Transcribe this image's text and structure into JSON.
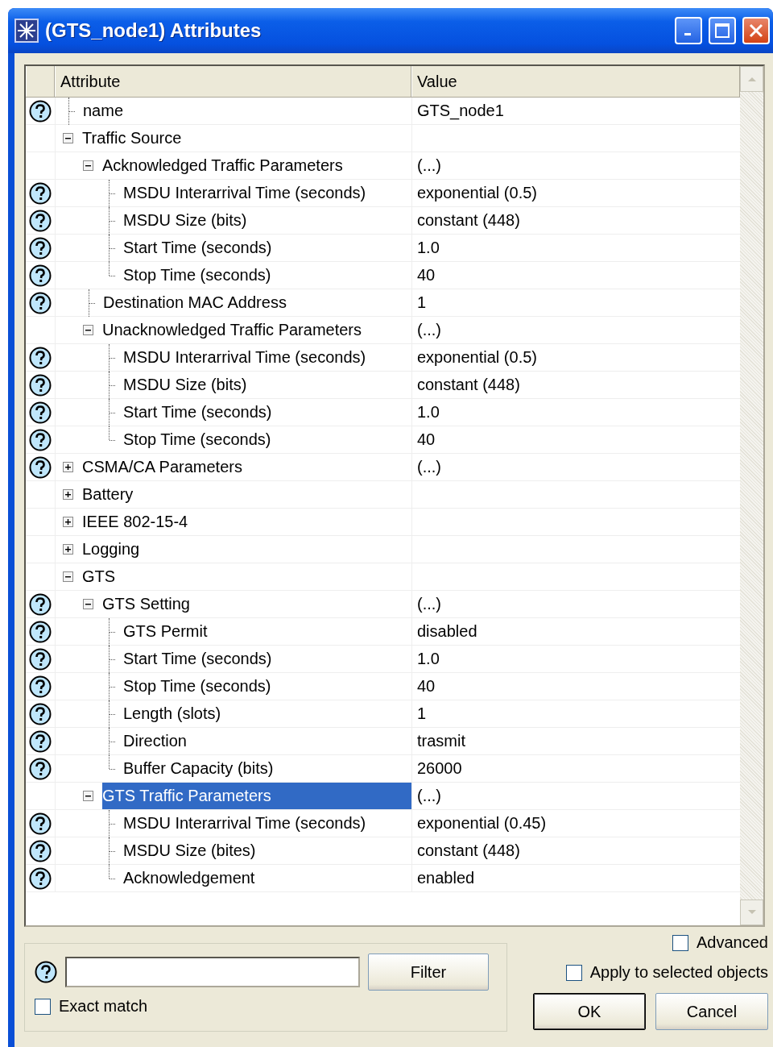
{
  "window": {
    "title": "(GTS_node1) Attributes"
  },
  "table": {
    "columns": [
      "Attribute",
      "Value"
    ],
    "rows": [
      {
        "label": "name",
        "value": "GTS_node1",
        "help": true,
        "selected": false
      },
      {
        "label": "Traffic Source",
        "help": false,
        "selected": false,
        "expanded": true,
        "children": [
          {
            "label": "Acknowledged Traffic Parameters",
            "value": "(...)",
            "help": false,
            "selected": false,
            "expanded": true,
            "children": [
              {
                "label": "MSDU Interarrival Time (seconds)",
                "value": "exponential (0.5)",
                "help": true,
                "selected": false
              },
              {
                "label": "MSDU Size (bits)",
                "value": "constant (448)",
                "help": true,
                "selected": false
              },
              {
                "label": "Start Time (seconds)",
                "value": "1.0",
                "help": true,
                "selected": false
              },
              {
                "label": "Stop Time (seconds)",
                "value": "40",
                "help": true,
                "selected": false
              }
            ]
          },
          {
            "label": "Destination MAC Address",
            "value": "1",
            "help": true,
            "selected": false
          },
          {
            "label": "Unacknowledged Traffic Parameters",
            "value": "(...)",
            "help": false,
            "selected": false,
            "expanded": true,
            "children": [
              {
                "label": "MSDU Interarrival Time (seconds)",
                "value": "exponential (0.5)",
                "help": true,
                "selected": false
              },
              {
                "label": "MSDU Size (bits)",
                "value": "constant (448)",
                "help": true,
                "selected": false
              },
              {
                "label": "Start Time (seconds)",
                "value": "1.0",
                "help": true,
                "selected": false
              },
              {
                "label": "Stop Time (seconds)",
                "value": "40",
                "help": true,
                "selected": false
              }
            ]
          }
        ]
      },
      {
        "label": "CSMA/CA Parameters",
        "value": "(...)",
        "help": true,
        "selected": false,
        "expanded": false,
        "children": []
      },
      {
        "label": "Battery",
        "help": false,
        "selected": false,
        "expanded": false,
        "children": []
      },
      {
        "label": "IEEE 802-15-4",
        "help": false,
        "selected": false,
        "expanded": false,
        "children": []
      },
      {
        "label": "Logging",
        "help": false,
        "selected": false,
        "expanded": false,
        "children": []
      },
      {
        "label": "GTS",
        "help": false,
        "selected": false,
        "expanded": true,
        "children": [
          {
            "label": "GTS Setting",
            "value": "(...)",
            "help": true,
            "selected": false,
            "expanded": true,
            "children": [
              {
                "label": "GTS Permit",
                "value": "disabled",
                "help": true,
                "selected": false
              },
              {
                "label": "Start Time (seconds)",
                "value": "1.0",
                "help": true,
                "selected": false
              },
              {
                "label": "Stop Time (seconds)",
                "value": "40",
                "help": true,
                "selected": false
              },
              {
                "label": "Length (slots)",
                "value": "1",
                "help": true,
                "selected": false
              },
              {
                "label": "Direction",
                "value": "trasmit",
                "help": true,
                "selected": false
              },
              {
                "label": "Buffer Capacity (bits)",
                "value": "26000",
                "help": true,
                "selected": false
              }
            ]
          },
          {
            "label": "GTS Traffic Parameters",
            "value": "(...)",
            "help": false,
            "selected": true,
            "expanded": true,
            "children": [
              {
                "label": "MSDU Interarrival Time (seconds)",
                "value": "exponential (0.45)",
                "help": true,
                "selected": false
              },
              {
                "label": "MSDU Size (bites)",
                "value": "constant (448)",
                "help": true,
                "selected": false
              },
              {
                "label": "Acknowledgement",
                "value": "enabled",
                "help": true,
                "selected": false
              }
            ]
          }
        ]
      }
    ]
  },
  "filter": {
    "button": "Filter",
    "exact_match": {
      "label": "Exact match",
      "checked": false
    }
  },
  "options": [
    {
      "label": "Advanced",
      "checked": false
    },
    {
      "label": "Apply to selected objects",
      "checked": false
    }
  ],
  "buttons": [
    "OK",
    "Cancel"
  ]
}
